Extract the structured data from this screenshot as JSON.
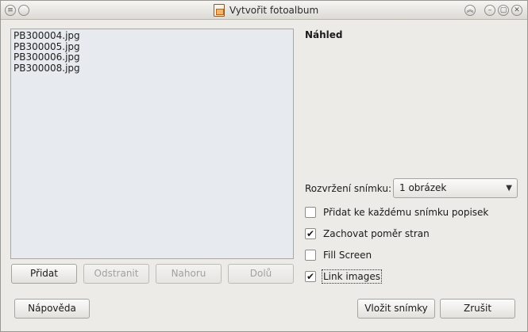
{
  "window": {
    "title": "Vytvořit fotoalbum"
  },
  "images": {
    "items": [
      "PB300004.jpg",
      "PB300005.jpg",
      "PB300006.jpg",
      "PB300008.jpg"
    ]
  },
  "list_buttons": {
    "add": "Přidat",
    "remove": "Odstranit",
    "up": "Nahoru",
    "down": "Dolů"
  },
  "preview": {
    "label": "Náhled"
  },
  "layout": {
    "label": "Rozvržení snímku:",
    "selected": "1 obrázek"
  },
  "options": [
    {
      "label": "Přidat ke každému snímku popisek",
      "checked": false
    },
    {
      "label": "Zachovat poměr stran",
      "checked": true
    },
    {
      "label": "Fill Screen",
      "checked": false
    },
    {
      "label": "Link images",
      "checked": true
    }
  ],
  "footer": {
    "help": "Nápověda",
    "insert": "Vložit snímky",
    "cancel": "Zrušit"
  },
  "icons": {
    "menu": "menu-icon",
    "close": "close-icon",
    "shade": "shade-icon",
    "minimize": "minimize-icon",
    "maximize": "maximize-icon",
    "checkmark": "✔"
  }
}
